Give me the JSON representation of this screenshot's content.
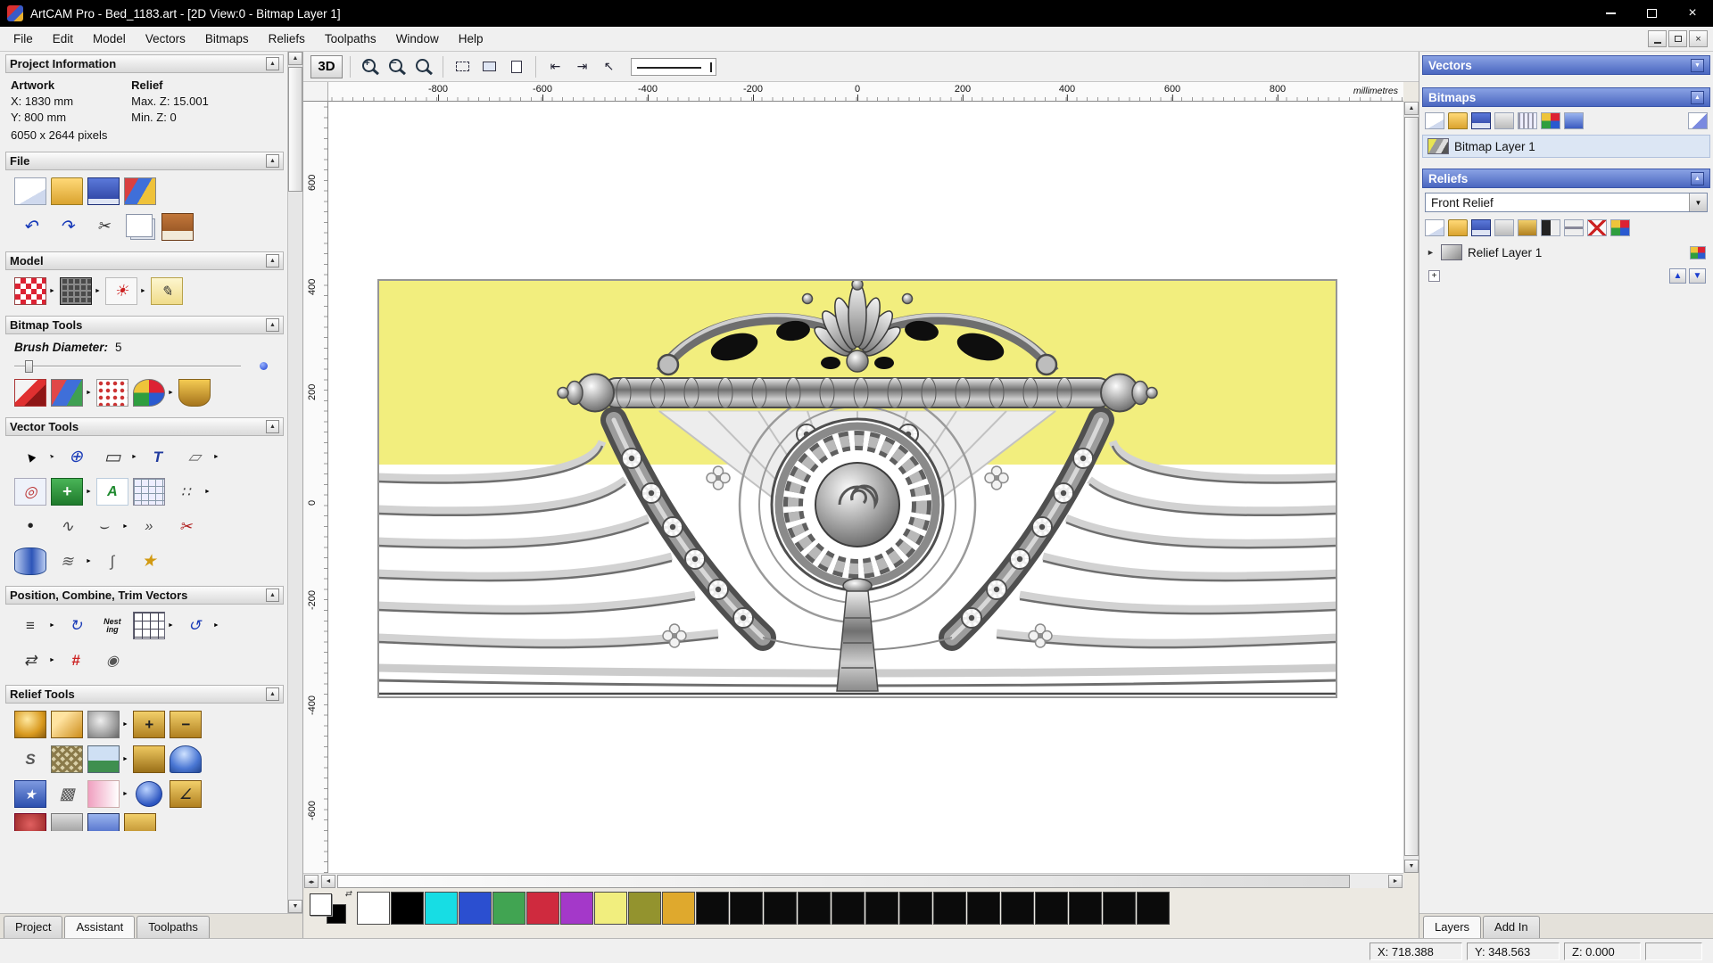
{
  "window": {
    "title": "ArtCAM Pro - Bed_1183.art - [2D View:0 - Bitmap Layer 1]"
  },
  "menu": [
    "File",
    "Edit",
    "Model",
    "Vectors",
    "Bitmaps",
    "Reliefs",
    "Toolpaths",
    "Window",
    "Help"
  ],
  "assistant": {
    "project_info_header": "Project Information",
    "artwork_label": "Artwork",
    "relief_label": "Relief",
    "artwork_x": "X: 1830 mm",
    "artwork_y": "Y: 800 mm",
    "relief_max_z": "Max. Z: 15.001",
    "relief_min_z": "Min. Z: 0",
    "artwork_pixels": "6050 x 2644 pixels",
    "file_header": "File",
    "model_header": "Model",
    "bitmap_tools_header": "Bitmap Tools",
    "brush_label": "Brush Diameter:",
    "brush_value": "5",
    "vector_tools_header": "Vector Tools",
    "position_header": "Position, Combine, Trim Vectors",
    "relief_tools_header": "Relief Tools",
    "tabs": [
      "Project",
      "Assistant",
      "Toolpaths"
    ]
  },
  "view": {
    "btn_3d": "3D"
  },
  "ruler": {
    "unit": "millimetres",
    "h_ticks": [
      "-800",
      "-600",
      "-400",
      "-200",
      "0",
      "200",
      "400",
      "600",
      "800"
    ],
    "v_ticks": [
      "600",
      "400",
      "200",
      "0",
      "-200",
      "-400",
      "-600"
    ]
  },
  "layers_panel": {
    "vectors_header": "Vectors",
    "bitmaps_header": "Bitmaps",
    "bitmap_layer": "Bitmap Layer 1",
    "reliefs_header": "Reliefs",
    "relief_combo": "Front Relief",
    "relief_layer": "Relief Layer 1",
    "tabs": [
      "Layers",
      "Add In"
    ]
  },
  "palette": {
    "primary": "#ffffff",
    "secondary": "#000000",
    "swatches": [
      "#ffffff",
      "#000000",
      "#17dde4",
      "#2b4fd0",
      "#41a452",
      "#cf2a3e",
      "#a438c9",
      "#f1ee7e",
      "#93932e",
      "#dfa92d",
      "#0b0b0b",
      "#0b0b0b",
      "#0b0b0b",
      "#0b0b0b",
      "#0b0b0b",
      "#0b0b0b",
      "#0b0b0b",
      "#0b0b0b",
      "#0b0b0b",
      "#0b0b0b",
      "#0b0b0b",
      "#0b0b0b",
      "#0b0b0b",
      "#0b0b0b"
    ]
  },
  "status": {
    "x": "X: 718.388",
    "y": "Y: 348.563",
    "z": "Z: 0.000"
  },
  "icons": {
    "collapse": "▲",
    "dropdown": "▼",
    "up": "▲",
    "down": "▼",
    "left": "◄",
    "right": "►",
    "split": "◂▸",
    "close": "×",
    "swap": "⇄",
    "fly": "►",
    "undo": "↶",
    "redo": "↷",
    "cut": "✂",
    "lighting": "☀",
    "notes": "✎",
    "select": "▲",
    "transform": "⊕",
    "rectangle": "▭",
    "text_tool": "T",
    "measure": "▱",
    "offset": "◎",
    "node_edit": "+",
    "abc": "A",
    "snap": "∷",
    "dot": "•",
    "freehand": "∿",
    "bezier": "⌣",
    "join": "»",
    "trim": "✂",
    "distort": "≋",
    "doctor": "∫",
    "star": "★",
    "align": "≡",
    "spin": "↻",
    "nesting": "Nesting",
    "rotate_copy": "↺",
    "mirror": "⇄",
    "fit": "#",
    "spiral": "◉",
    "add_relief": "+",
    "subtract_relief": "−",
    "two_rail": "S",
    "texture": "▩",
    "angle": "∠",
    "star_relief": "★",
    "zoom_in": "+",
    "zoom_out": "−"
  }
}
